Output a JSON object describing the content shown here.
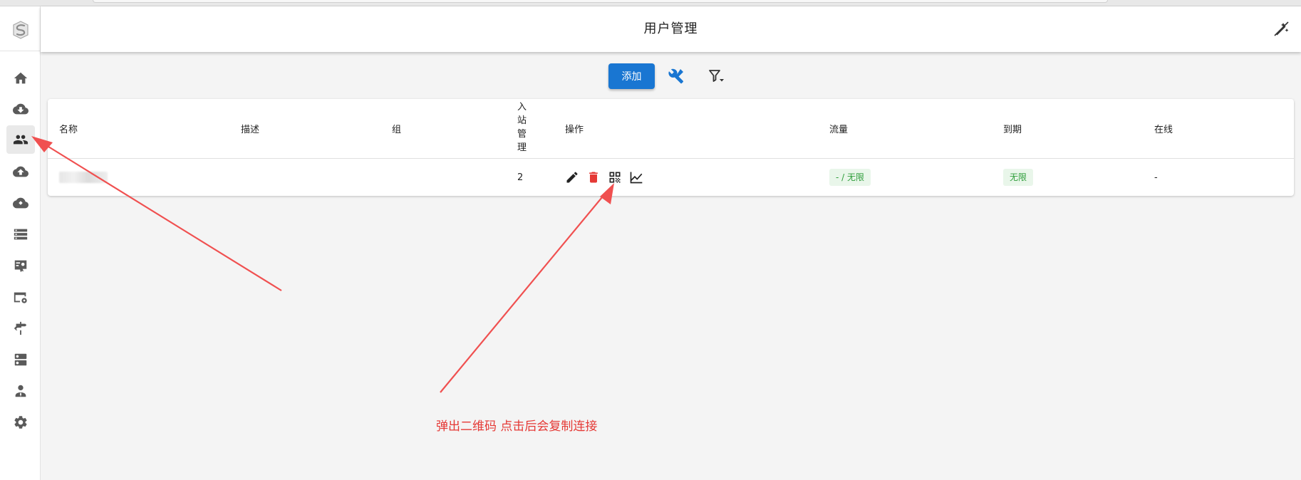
{
  "app": {
    "title": "用户管理"
  },
  "colors": {
    "primary": "#1976d2",
    "danger": "#e53935",
    "chip_bg": "#e9f6ea",
    "chip_text": "#2e9d3a",
    "annotation": "#f05050"
  },
  "sidebar": {
    "logo_icon": "rocket-logo-icon",
    "items": [
      {
        "icon": "home-icon",
        "active": false
      },
      {
        "icon": "cloud-download-icon",
        "active": false
      },
      {
        "icon": "people-icon",
        "active": true
      },
      {
        "icon": "cloud-upload-icon",
        "active": false
      },
      {
        "icon": "cloud-sync-icon",
        "active": false
      },
      {
        "icon": "storage-list-icon",
        "active": false
      },
      {
        "icon": "certificate-icon",
        "active": false
      },
      {
        "icon": "web-settings-icon",
        "active": false
      },
      {
        "icon": "signpost-icon",
        "active": false
      },
      {
        "icon": "dns-icon",
        "active": false
      },
      {
        "icon": "admin-user-icon",
        "active": false
      },
      {
        "icon": "gear-icon",
        "active": false
      }
    ]
  },
  "toolbar": {
    "add_label": "添加",
    "tools_icon": "tools-icon",
    "filter_icon": "filter-icon"
  },
  "table": {
    "headers": {
      "name": "名称",
      "description": "描述",
      "group": "组",
      "inbound": "入站管理",
      "actions": "操作",
      "traffic": "流量",
      "expiry": "到期",
      "online": "在线"
    },
    "rows": [
      {
        "name": "",
        "description": "",
        "group": "",
        "inbound": "2",
        "traffic": "- / 无限",
        "expiry": "无限",
        "online": "-",
        "action_icons": [
          "edit-icon",
          "delete-icon",
          "qrcode-icon",
          "chart-icon"
        ]
      }
    ]
  },
  "annotation": {
    "text": "弹出二维码 点击后会复制连接"
  }
}
